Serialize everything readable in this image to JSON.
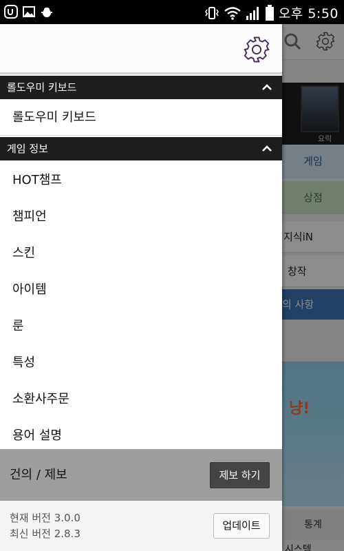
{
  "status_bar": {
    "left_icons": [
      "app-notification-icon",
      "image-icon",
      "android-debug-icon"
    ],
    "right_icons": [
      "vibrate-icon",
      "wifi-icon",
      "signal-icon",
      "battery-icon"
    ],
    "time": "오후 5:50"
  },
  "drawer": {
    "header": {
      "settings_icon": "gear-icon"
    },
    "section_keyboard": {
      "title": "롤도우미 키보드",
      "items": [
        {
          "label": "롤도우미 키보드"
        }
      ]
    },
    "section_game": {
      "title": "게임 정보",
      "items": [
        {
          "label": "HOT챔프"
        },
        {
          "label": "챔피언"
        },
        {
          "label": "스킨"
        },
        {
          "label": "아이템"
        },
        {
          "label": "룬"
        },
        {
          "label": "특성"
        },
        {
          "label": "소환사주문"
        },
        {
          "label": "용어 설명"
        }
      ]
    },
    "feedback": {
      "label": "건의 / 제보",
      "button": "제보 하기"
    },
    "version": {
      "current": "현재 버전 3.0.0",
      "latest": "최신 버전 2.8.3",
      "button": "업데이트"
    }
  },
  "background_app": {
    "champion_name": "요릭",
    "tab_game": "게임",
    "tab_store": "상점",
    "menu_knowledge": "지식iN",
    "menu_creation": "창작",
    "notice": "의 사항",
    "banner_text": "냥!",
    "stats": "통계",
    "bottom_text": "시스템"
  },
  "colors": {
    "section_header_bg": "#1e1e1e",
    "feedback_bg": "#9e9e9e",
    "gear_purple": "#4a2a5a",
    "notice_blue": "#3f74b7"
  }
}
